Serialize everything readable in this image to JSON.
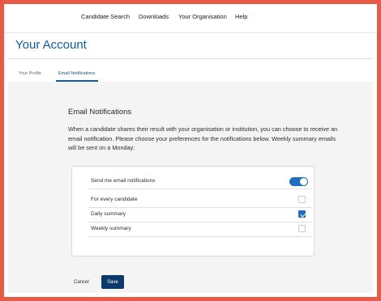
{
  "nav": {
    "items": [
      "Candidate Search",
      "Downloads",
      "Your Organisation",
      "Help"
    ]
  },
  "page": {
    "title": "Your Account"
  },
  "tabs": [
    {
      "label": "Your Profile",
      "active": false
    },
    {
      "label": "Email Notifications",
      "active": true
    }
  ],
  "section": {
    "heading": "Email Notifications",
    "intro": "When a candidate shares their result with your organisation or institution, you can choose to receive an email notification. Please choose your preferences for the notifications below. Weekly summary emails will be sent on a Monday:"
  },
  "preferences": {
    "toggle": {
      "label": "Send me email notifications",
      "on": true
    },
    "options": [
      {
        "label": "For every candidate",
        "checked": false
      },
      {
        "label": "Daily summary",
        "checked": true
      },
      {
        "label": "Weekly summary",
        "checked": false
      }
    ]
  },
  "actions": {
    "cancel": "Cancel",
    "save": "Save"
  },
  "colors": {
    "frame_border": "#e85a45",
    "accent": "#0d5ba8",
    "save_button": "#0b3a6d",
    "toggle_on": "#1f6fc0"
  }
}
